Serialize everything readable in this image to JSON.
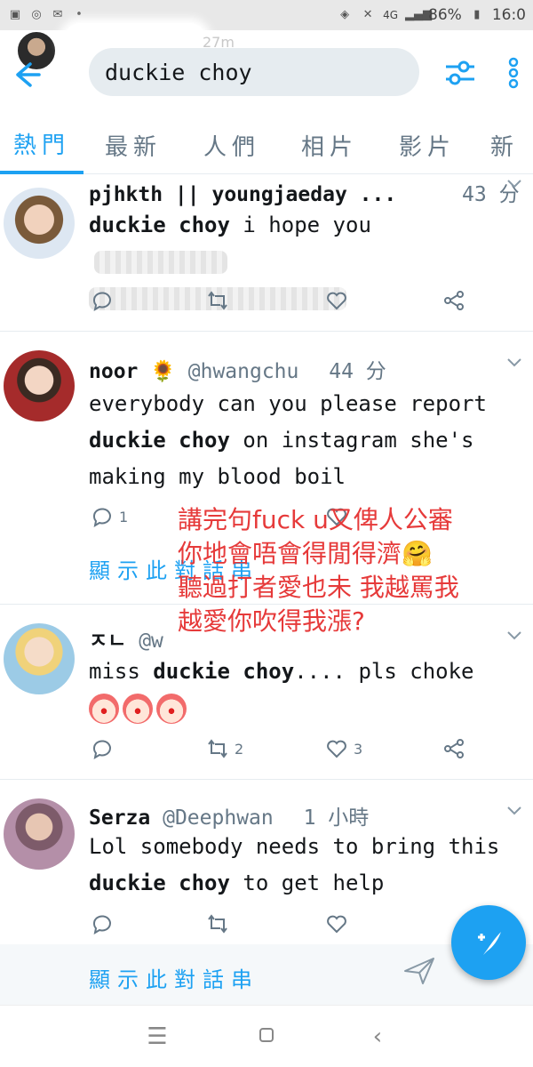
{
  "status_bar": {
    "left_icons": [
      "message-icon",
      "whatsapp-icon",
      "gmail-icon",
      "more-dots"
    ],
    "network": "4G",
    "battery": "86%",
    "time": "16:0"
  },
  "header": {
    "search_query": "duckie choy",
    "blurred_tail": "27m"
  },
  "tabs": [
    "熱門",
    "最新",
    "人們",
    "相片",
    "影片",
    "新"
  ],
  "tweets": [
    {
      "name": "pjhkth || youngjaeday ...",
      "handle": "",
      "time": "43 分",
      "body_bold": "duckie choy",
      "body_rest": " i hope you",
      "reply_count": "",
      "retweet_count": "",
      "like_count": ""
    },
    {
      "name": "noor",
      "emoji": "🌻",
      "handle": "@hwangchu",
      "time": "44 分",
      "body_pre": "everybody can you please report ",
      "body_bold": "duckie choy",
      "body_rest": " on instagram she's making my blood boil",
      "reply_count": "1",
      "thread_link": "顯示此對話串"
    },
    {
      "name": "ㅈㄴ",
      "handle": "@w",
      "time": "",
      "body_pre": "miss ",
      "body_bold": "duckie choy",
      "body_rest": ".... pls choke",
      "retweet_count": "2",
      "like_count": "3"
    },
    {
      "name": "Serza",
      "handle": "@Deephwan",
      "time": "1 小時",
      "body_pre": "Lol somebody needs to bring this ",
      "body_bold": "duckie choy",
      "body_rest": " to get help",
      "thread_link": "顯示此對話串"
    }
  ],
  "overlay_caption": {
    "line1": "講完句fuck u又俾人公審",
    "line2": "你地會唔會得閒得濟🤗",
    "line3": "聽過打者愛也未  我越罵我",
    "line4": "越愛你吹得我漲?"
  },
  "colors": {
    "accent": "#1da1f2",
    "overlay_text": "#e63a3a",
    "secondary_text": "#657786"
  }
}
